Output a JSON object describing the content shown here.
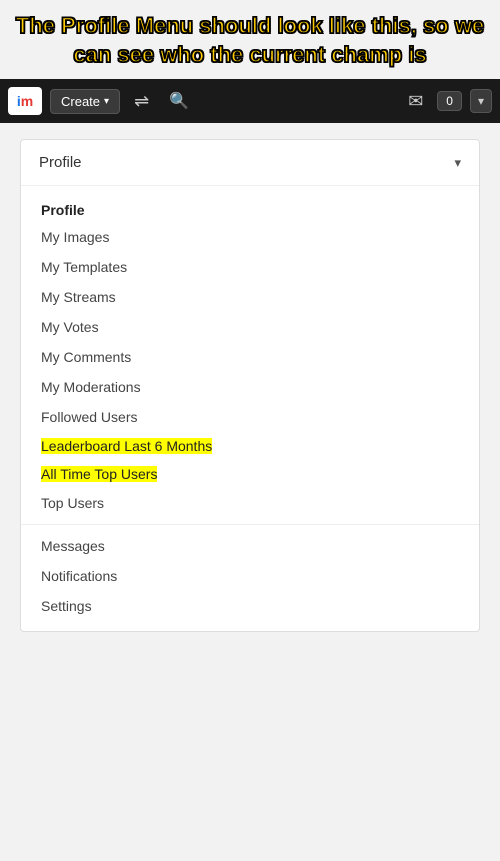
{
  "annotation": {
    "text": "The Profile Menu should look like this, so we can see who the current champ is"
  },
  "navbar": {
    "logo_i": "i",
    "logo_m": "m",
    "create_label": "Create",
    "create_chevron": "▾",
    "shuffle_icon": "⇌",
    "search_icon": "🔍",
    "mail_icon": "✉",
    "notification_count": "0",
    "dropdown_chevron": "▾"
  },
  "profile_dropdown": {
    "header_label": "Profile",
    "header_chevron": "▾",
    "section_header": "Profile",
    "items": [
      {
        "label": "My Images",
        "highlight": false
      },
      {
        "label": "My Templates",
        "highlight": false
      },
      {
        "label": "My Streams",
        "highlight": false
      },
      {
        "label": "My Votes",
        "highlight": false
      },
      {
        "label": "My Comments",
        "highlight": false
      },
      {
        "label": "My Moderations",
        "highlight": false
      },
      {
        "label": "Followed Users",
        "highlight": false
      },
      {
        "label": "Leaderboard Last 6 Months",
        "highlight": true
      },
      {
        "label": "All Time Top Users",
        "highlight": true
      },
      {
        "label": "Top Users",
        "highlight": false
      },
      {
        "label": "Messages",
        "highlight": false
      },
      {
        "label": "Notifications",
        "highlight": false
      },
      {
        "label": "Settings",
        "highlight": false
      }
    ]
  }
}
